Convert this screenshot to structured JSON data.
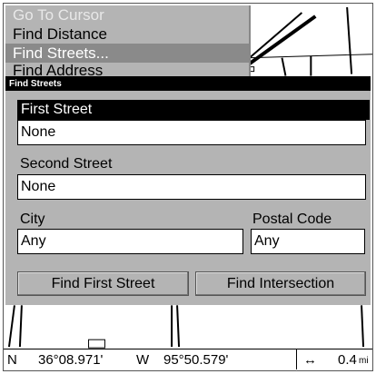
{
  "menu": {
    "items": [
      {
        "label": "Go To Cursor",
        "state": "disabled"
      },
      {
        "label": "Find Distance",
        "state": "normal"
      },
      {
        "label": "Find Streets...",
        "state": "selected"
      },
      {
        "label": "Find Address",
        "state": "cut"
      }
    ]
  },
  "dialog": {
    "title": "Find Streets",
    "first_street_label": "First Street",
    "first_street_value": "None",
    "second_street_label": "Second Street",
    "second_street_value": "None",
    "city_label": "City",
    "city_value": "Any",
    "postal_label": "Postal Code",
    "postal_value": "Any",
    "find_first_button": "Find First Street",
    "find_intersection_button": "Find Intersection"
  },
  "status": {
    "lat_hemisphere": "N",
    "lat_value": "36°08.971'",
    "lon_hemisphere": "W",
    "lon_value": "95°50.579'",
    "scale_icon": "horizontal-double-arrow-icon",
    "scale_value": "0.4",
    "scale_unit": "mi"
  },
  "colors": {
    "dialog_bg": "#b4b4b4",
    "title_bg": "#000000",
    "menu_selected": "#8a8a8a"
  }
}
